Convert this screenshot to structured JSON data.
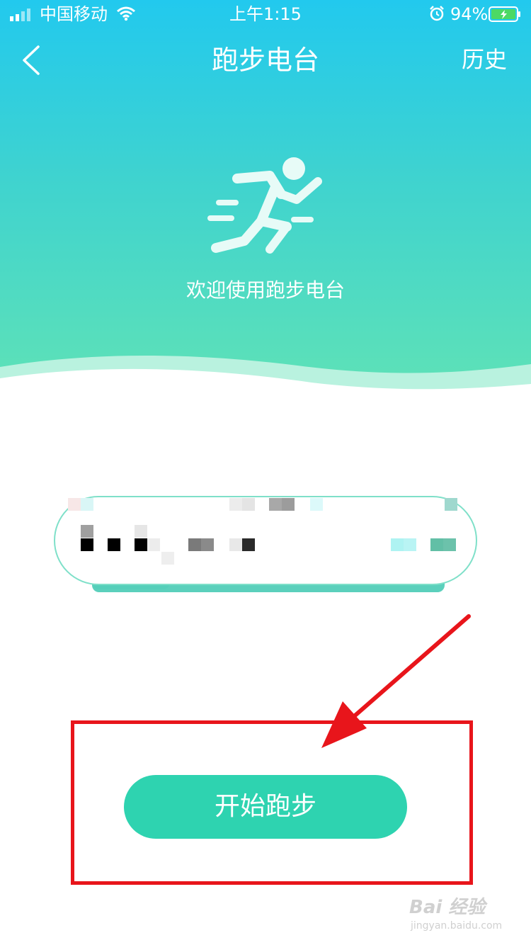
{
  "status_bar": {
    "carrier": "中国移动",
    "time": "上午1:15",
    "battery": "94%",
    "icons": [
      "signal-icon",
      "wifi-icon",
      "alarm-icon",
      "battery-icon"
    ]
  },
  "nav": {
    "title": "跑步电台",
    "history": "历史",
    "back_icon": "chevron-left-icon"
  },
  "hero": {
    "icon": "runner-icon",
    "welcome": "欢迎使用跑步电台"
  },
  "main": {
    "start_button": "开始跑步"
  },
  "watermark": {
    "logo": "Bai 经验",
    "url": "jingyan.baidu.com"
  },
  "colors": {
    "gradient_top": "#22c9ee",
    "gradient_bottom": "#5fe2b6",
    "accent": "#2ed3b0",
    "annotation": "#e8151b"
  }
}
